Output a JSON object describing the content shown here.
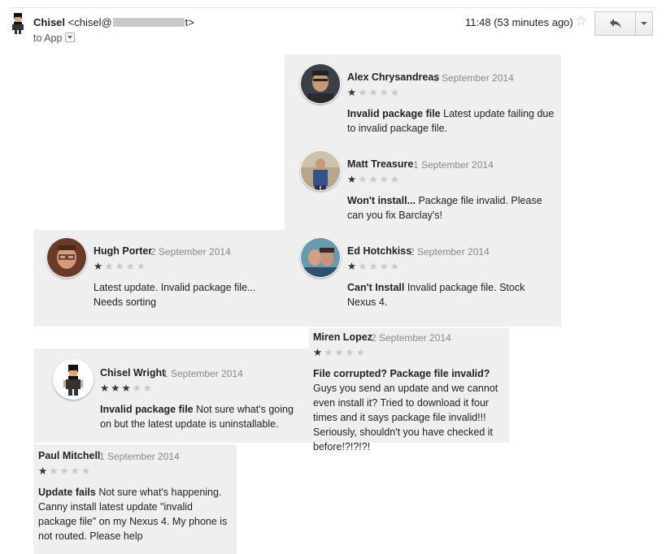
{
  "email": {
    "sender_name": "Chisel",
    "sender_email_prefix": "<chisel@",
    "sender_email_suffix": "t>",
    "to_label": "to App",
    "time": "11:48 (53 minutes ago)"
  },
  "colors": {
    "panel_bg": "#efefef",
    "star_on": "#333333",
    "star_off": "#c8c8c8"
  },
  "reviews": [
    {
      "name": "Alex Chrysandreas",
      "date": "1 September 2014",
      "rating": 1,
      "title": "Invalid package file",
      "body": " Latest update failing due to invalid package file."
    },
    {
      "name": "Matt Treasure",
      "date": "1 September 2014",
      "rating": 1,
      "title": "Won't install...",
      "body": " Package file invalid. Please can you fix Barclay's!"
    },
    {
      "name": "Hugh Porter",
      "date": "2 September 2014",
      "rating": 1,
      "title": "",
      "body": "Latest update. Invalid package file... Needs sorting"
    },
    {
      "name": "Ed Hotchkiss",
      "date": "2 September 2014",
      "rating": 1,
      "title": "Can't Install",
      "body": " Invalid package file. Stock Nexus 4."
    },
    {
      "name": "Miren Lopez",
      "date": "2 September 2014",
      "rating": 1,
      "title": "File corrupted? Package file invalid?",
      "body": " Guys you send an update and we cannot even install it? Tried to download it four times and it says package file invalid!!! Seriously, shouldn't you have checked it before!?!?!?!"
    },
    {
      "name": "Chisel Wright",
      "date": "1 September 2014",
      "rating": 3,
      "title": "Invalid package file",
      "body": " Not sure what's going on but the latest update is uninstallable."
    },
    {
      "name": "Paul Mitchell",
      "date": "1 September 2014",
      "rating": 1,
      "title": "Update fails",
      "body": " Not sure what's happening. Canny install latest update \"invalid package file\" on my Nexus 4. My phone is not routed. Please help"
    }
  ]
}
